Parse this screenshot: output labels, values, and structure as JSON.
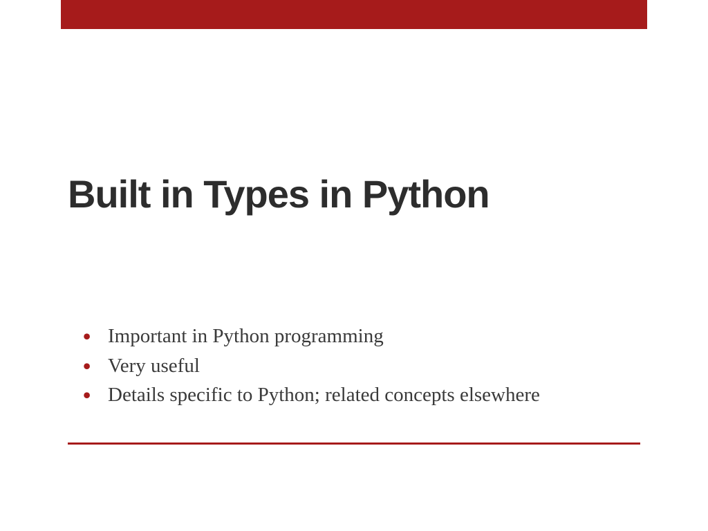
{
  "slide": {
    "title": "Built in Types in Python",
    "bullets": [
      "Important in Python programming",
      "Very useful",
      "Details specific to Python; related concepts elsewhere"
    ]
  },
  "theme": {
    "accentColor": "#a61b1b",
    "titleColor": "#2d2d2d",
    "textColor": "#3a3a3a"
  }
}
